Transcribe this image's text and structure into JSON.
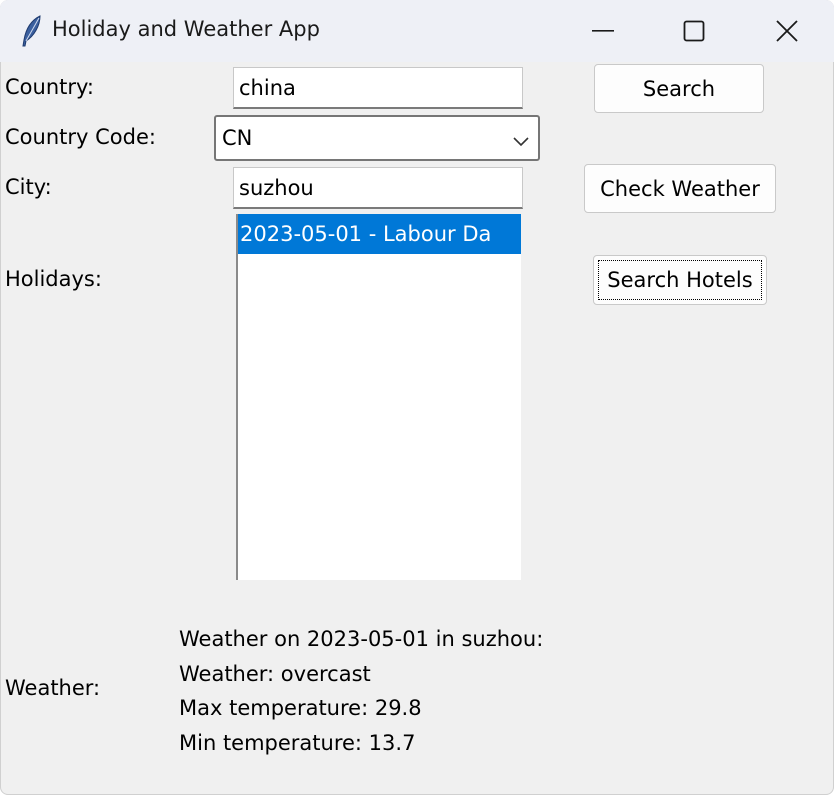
{
  "window": {
    "title": "Holiday and Weather App",
    "icon": "feather-icon"
  },
  "country": {
    "label": "Country:",
    "value": "china"
  },
  "country_code": {
    "label": "Country Code:",
    "selected": "CN"
  },
  "city": {
    "label": "City:",
    "value": "suzhou"
  },
  "buttons": {
    "search": "Search",
    "check_weather": "Check Weather",
    "search_hotels": "Search Hotels"
  },
  "holidays": {
    "label": "Holidays:",
    "items": [
      "2023-05-01 - Labour Da"
    ],
    "selected_index": 0
  },
  "weather": {
    "label": "Weather:",
    "lines": [
      "Weather on 2023-05-01 in suzhou:",
      "Weather: overcast",
      "Max temperature: 29.8",
      "Min temperature: 13.7"
    ]
  },
  "colors": {
    "selection": "#0078d7",
    "window_bg": "#f0f0f0",
    "titlebar_bg": "#eef0f6"
  }
}
